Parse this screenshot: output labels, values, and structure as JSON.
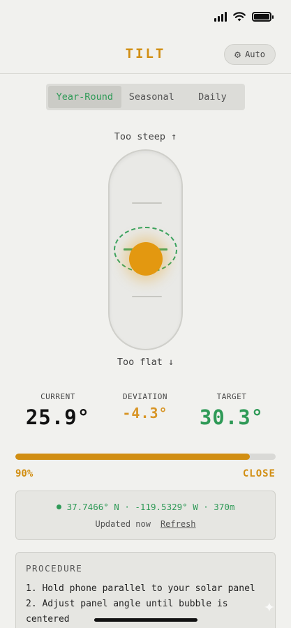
{
  "status_bar": {
    "icons": [
      "cellular-signal-icon",
      "wifi-icon",
      "battery-icon"
    ]
  },
  "header": {
    "title": "TILT",
    "auto_button": {
      "icon": "gear-icon",
      "label": "Auto"
    }
  },
  "mode_tabs": {
    "items": [
      {
        "label": "Year-Round",
        "active": true
      },
      {
        "label": "Seasonal",
        "active": false
      },
      {
        "label": "Daily",
        "active": false
      }
    ]
  },
  "level": {
    "top_hint": "Too steep ↑",
    "bottom_hint": "Too flat ↓",
    "bubble_color": "#e39810",
    "target_color": "#3aa35f"
  },
  "metrics": {
    "current": {
      "label": "CURRENT",
      "value": "25.9°"
    },
    "deviation": {
      "label": "DEVIATION",
      "value": "-4.3°"
    },
    "target": {
      "label": "TARGET",
      "value": "30.3°"
    }
  },
  "progress": {
    "percent_label": "90%",
    "fraction": 0.9,
    "state": "CLOSE",
    "color": "#d18e12"
  },
  "location": {
    "coords": "37.7466° N · -119.5329° W · 370m",
    "updated": "Updated now",
    "refresh_label": "Refresh"
  },
  "procedure": {
    "title": "PROCEDURE",
    "steps": [
      "1. Hold phone parallel to your solar panel",
      "2. Adjust panel angle until bubble is centered"
    ]
  },
  "colors": {
    "accent": "#d18e12",
    "success": "#2f9a57",
    "background": "#f1f1ee"
  }
}
